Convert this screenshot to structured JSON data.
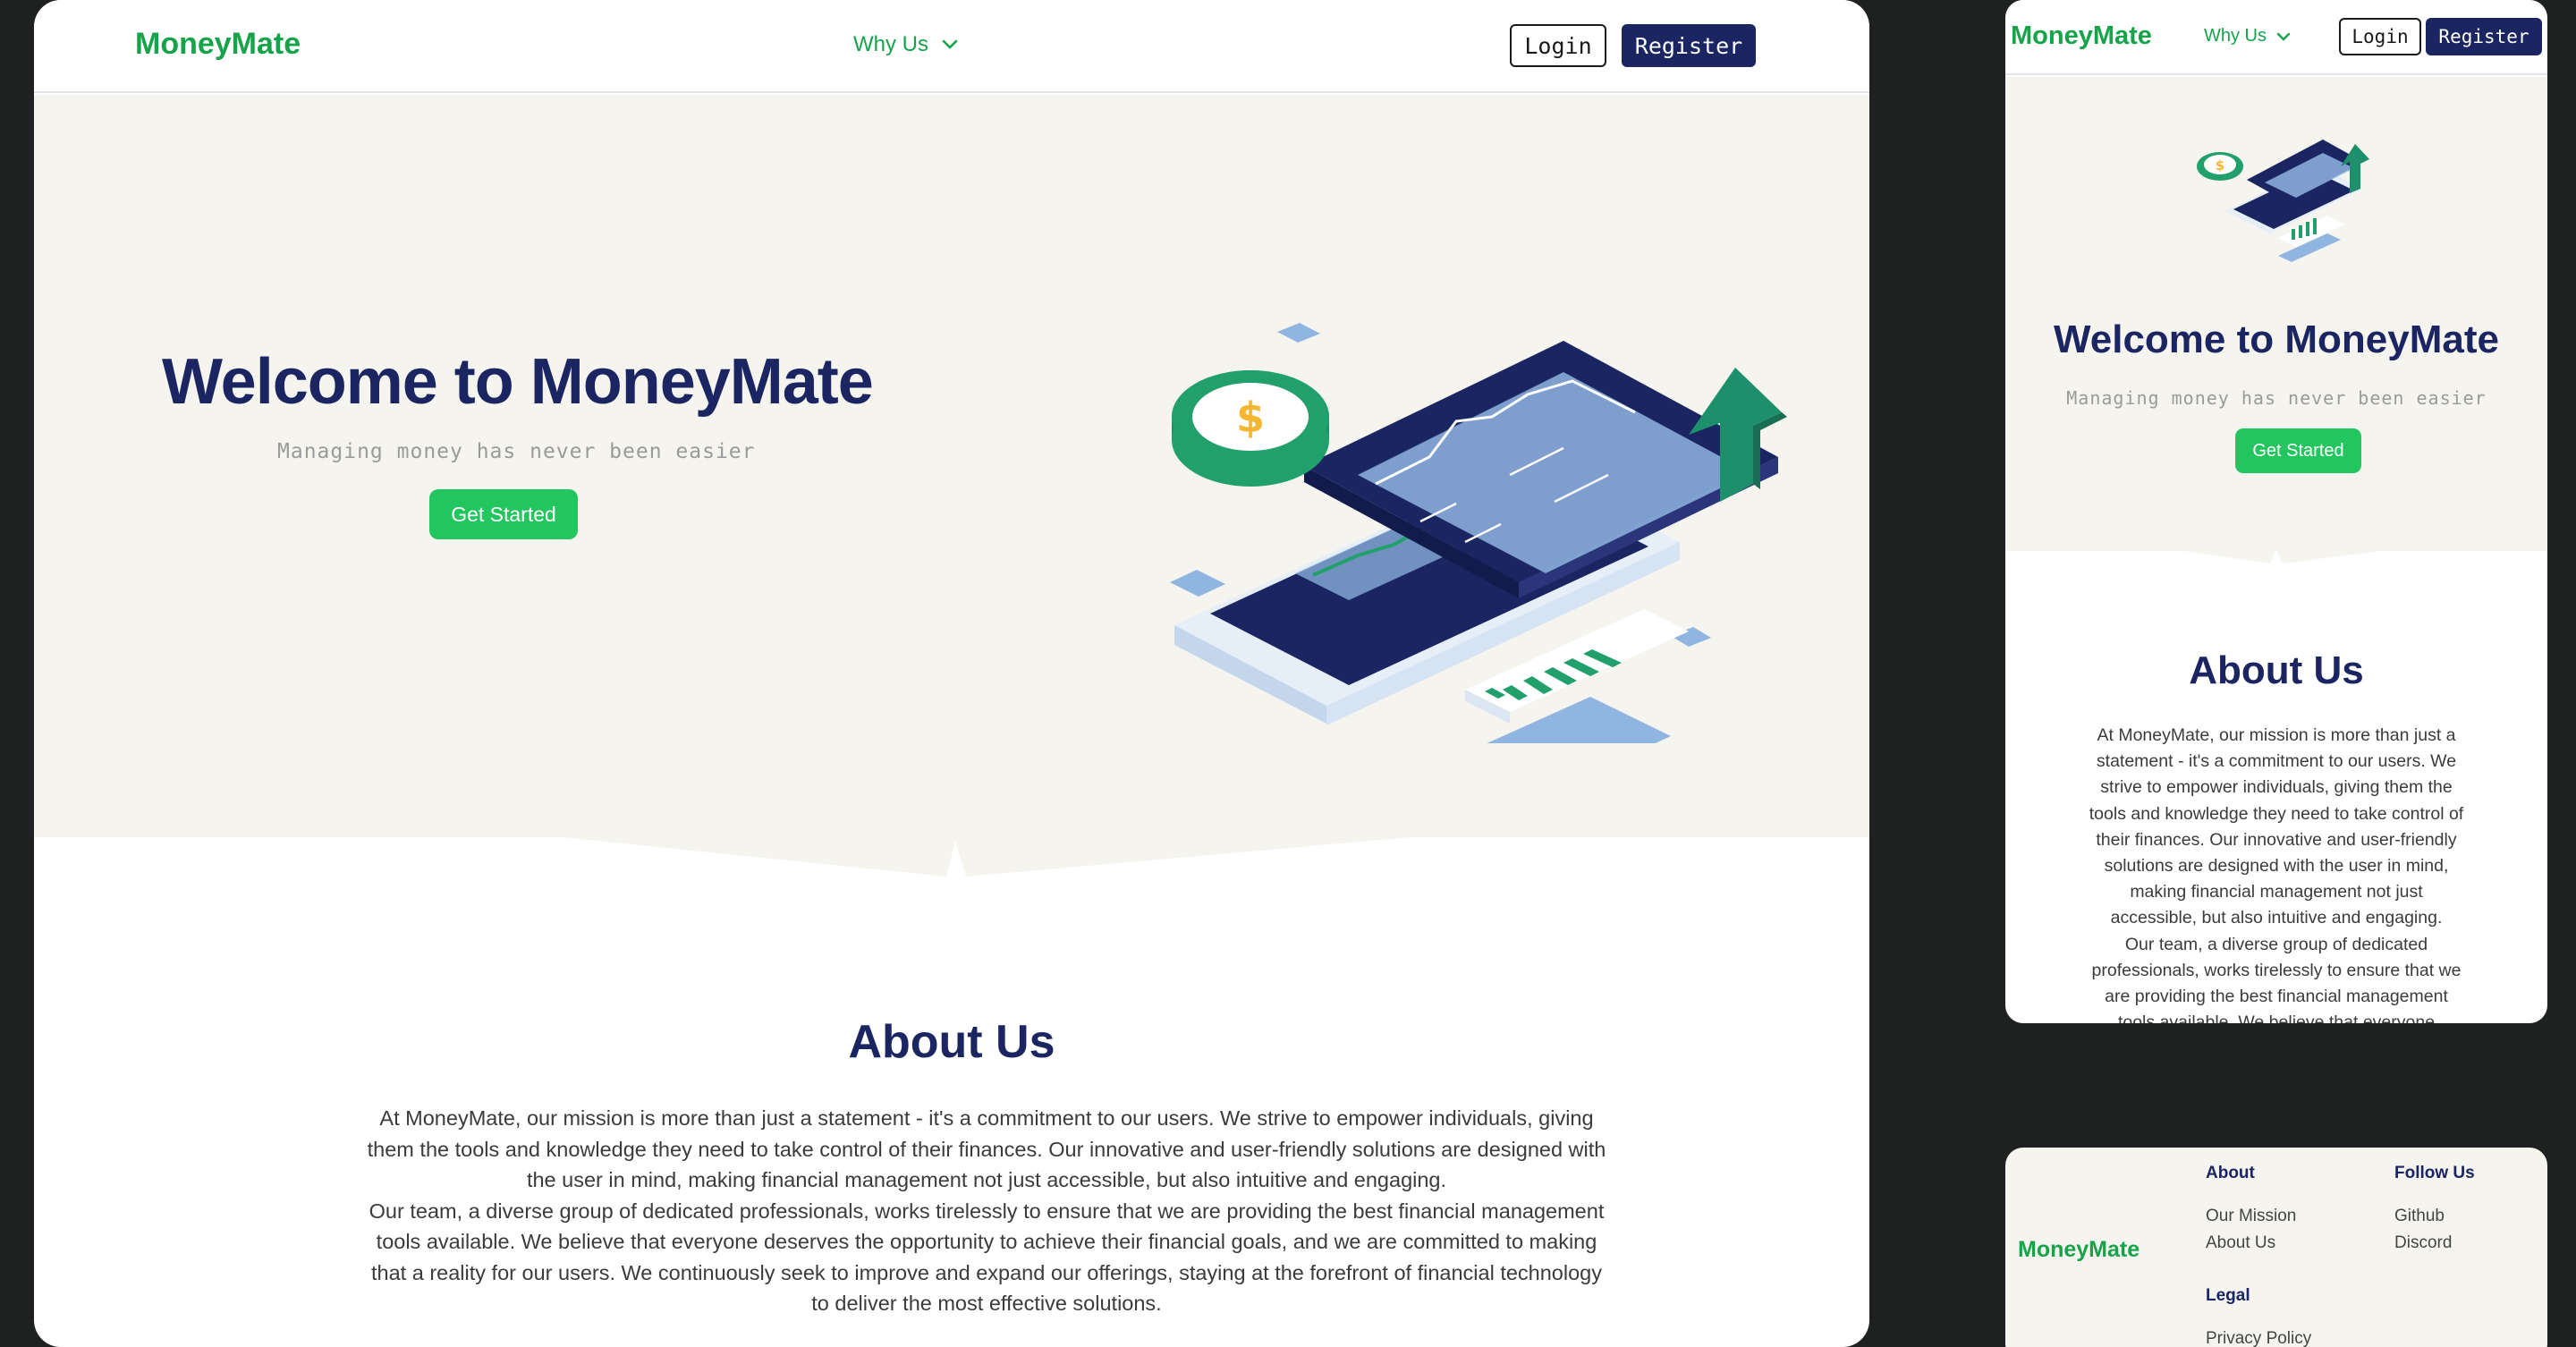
{
  "brand": {
    "name": "MoneyMate",
    "colors": {
      "brand_green": "#16a34a",
      "cta_green": "#22c55e",
      "navy": "#1b2561",
      "hero_bg": "#f5f4ef",
      "page_bg": "#1e2120"
    }
  },
  "nav": {
    "why_us": "Why Us",
    "login": "Login",
    "register": "Register"
  },
  "hero": {
    "title": "Welcome to MoneyMate",
    "subtitle": "Managing money has never been easier",
    "cta": "Get Started"
  },
  "about": {
    "title": "About Us",
    "paragraph1": "At MoneyMate, our mission is more than just a statement - it's a commitment to our users. We strive to empower individuals, giving them the tools and knowledge they need to take control of their finances. Our innovative and user-friendly solutions are designed with the user in mind, making financial management not just accessible, but also intuitive and engaging.",
    "paragraph2": "Our team, a diverse group of dedicated professionals, works tirelessly to ensure that we are providing the best financial management tools available. We believe that everyone deserves the opportunity to achieve their financial goals, and we are committed to making that a reality for our users. We continuously seek to improve and expand our offerings, staying at the forefront of financial technology to deliver the most effective solutions."
  },
  "footer": {
    "about": {
      "heading": "About",
      "links": [
        "Our Mission",
        "About Us"
      ]
    },
    "follow": {
      "heading": "Follow Us",
      "links": [
        "Github",
        "Discord"
      ]
    },
    "legal": {
      "heading": "Legal",
      "links": [
        "Privacy Policy"
      ]
    }
  }
}
